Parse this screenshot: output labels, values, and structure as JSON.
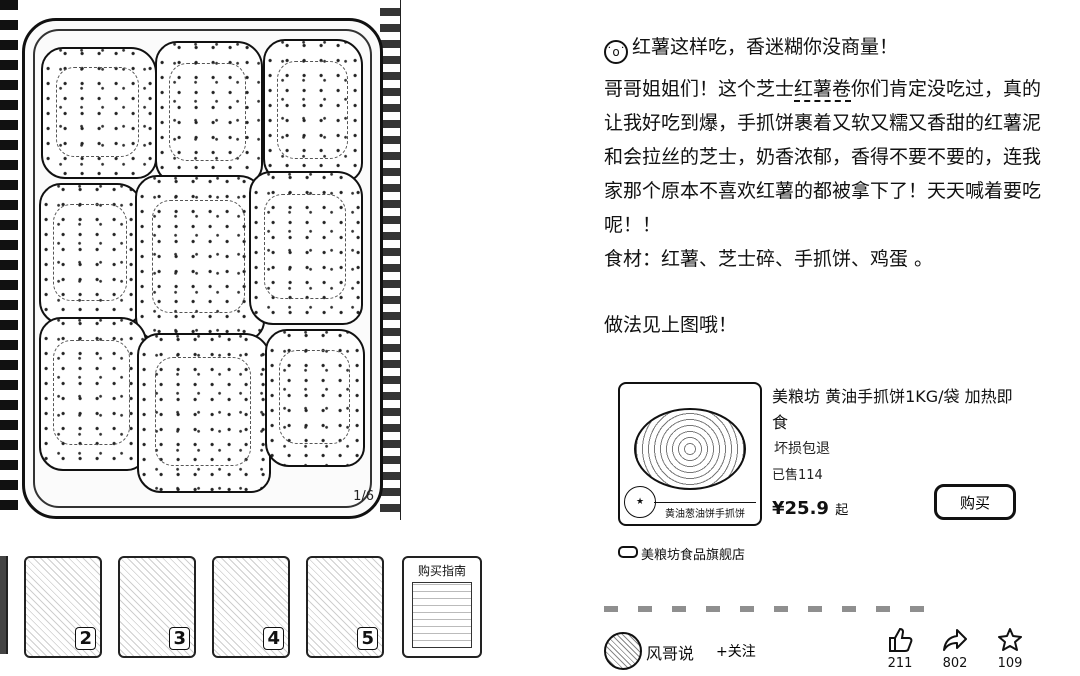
{
  "image": {
    "counter": "1/6"
  },
  "thumbnails": [
    {
      "num": "2"
    },
    {
      "num": "3"
    },
    {
      "num": "4"
    },
    {
      "num": "5"
    },
    {
      "guide_title": "购买指南"
    }
  ],
  "post": {
    "title": "红薯这样吃，香迷糊你没商量！",
    "body_1": "哥哥姐姐们！这个芝士",
    "keyword": "红薯卷",
    "body_2": "你们肯定没吃过，真的让我好吃到爆，手抓饼裹着又软又糯又香甜的红薯泥和会拉丝的芝士，奶香浓郁，香得不要不要的，连我家那个原本不喜欢红薯的都被拿下了！天天喊着要吃呢！！",
    "ingredients": "食材：红薯、芝士碎、手抓饼、鸡蛋 。",
    "method": "做法见上图哦！"
  },
  "product": {
    "name": "美粮坊 黄油手抓饼1KG/袋 加热即食",
    "tag": "坏损包退",
    "sold": "已售114",
    "price": "¥25.9",
    "price_suffix": "起",
    "buy_label": "购买",
    "image_label": "黄油葱油饼手抓饼",
    "shop": "美粮坊食品旗舰店"
  },
  "author": {
    "name": "风哥说",
    "follow": "+关注"
  },
  "actions": {
    "likes": "211",
    "shares": "802",
    "favorites": "109"
  }
}
